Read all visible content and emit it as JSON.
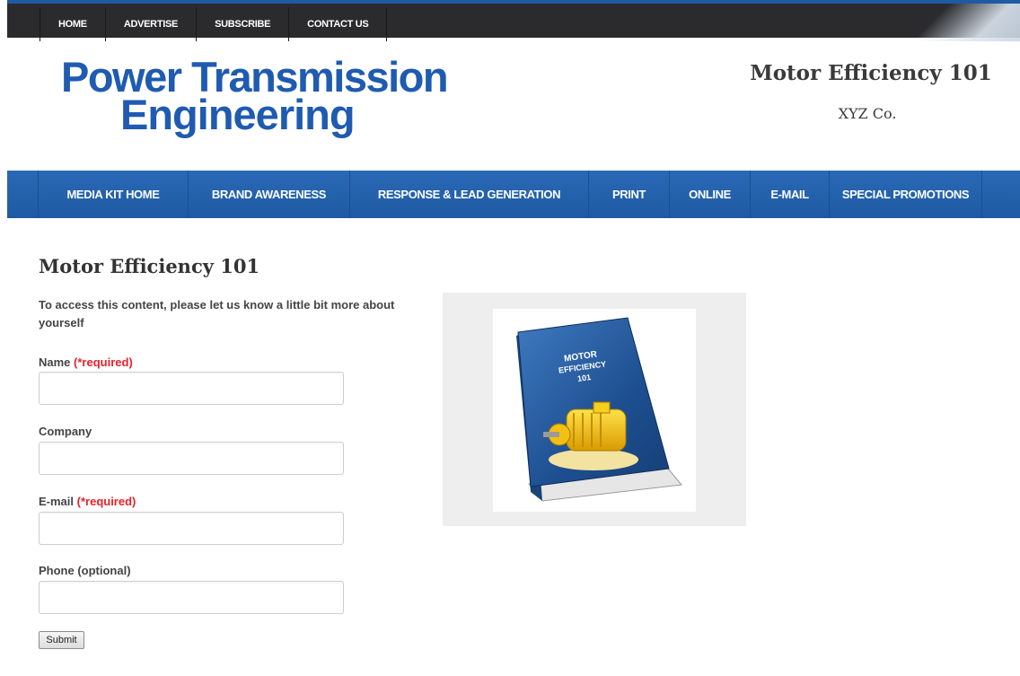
{
  "top_nav": [
    "HOME",
    "ADVERTISE",
    "SUBSCRIBE",
    "CONTACT US"
  ],
  "logo": {
    "line1": "Power Transmission",
    "line2": "Engineering"
  },
  "header": {
    "title": "Motor Efficiency 101",
    "company": "XYZ Co."
  },
  "main_nav": [
    "MEDIA KIT HOME",
    "BRAND AWARENESS",
    "RESPONSE & LEAD GENERATION",
    "PRINT",
    "ONLINE",
    "E-MAIL",
    "SPECIAL PROMOTIONS"
  ],
  "page": {
    "title": "Motor Efficiency 101",
    "intro": "To access this content, please let us know a little bit more about yourself"
  },
  "form": {
    "fields": [
      {
        "label": "Name",
        "required": "(*required)",
        "value": ""
      },
      {
        "label": "Company",
        "required": "",
        "value": ""
      },
      {
        "label": "E-mail",
        "required": "(*required)",
        "value": ""
      },
      {
        "label": "Phone (optional)",
        "required": "",
        "value": ""
      }
    ],
    "submit": "Submit"
  },
  "book": {
    "cover_line1": "MOTOR",
    "cover_line2": "EFFICIENCY",
    "cover_line3": "101"
  },
  "colors": {
    "brand_blue": "#1f5bb0",
    "nav_blue": "#2a69b6",
    "topbar": "#2b2b2e",
    "required_red": "#e8202a"
  }
}
